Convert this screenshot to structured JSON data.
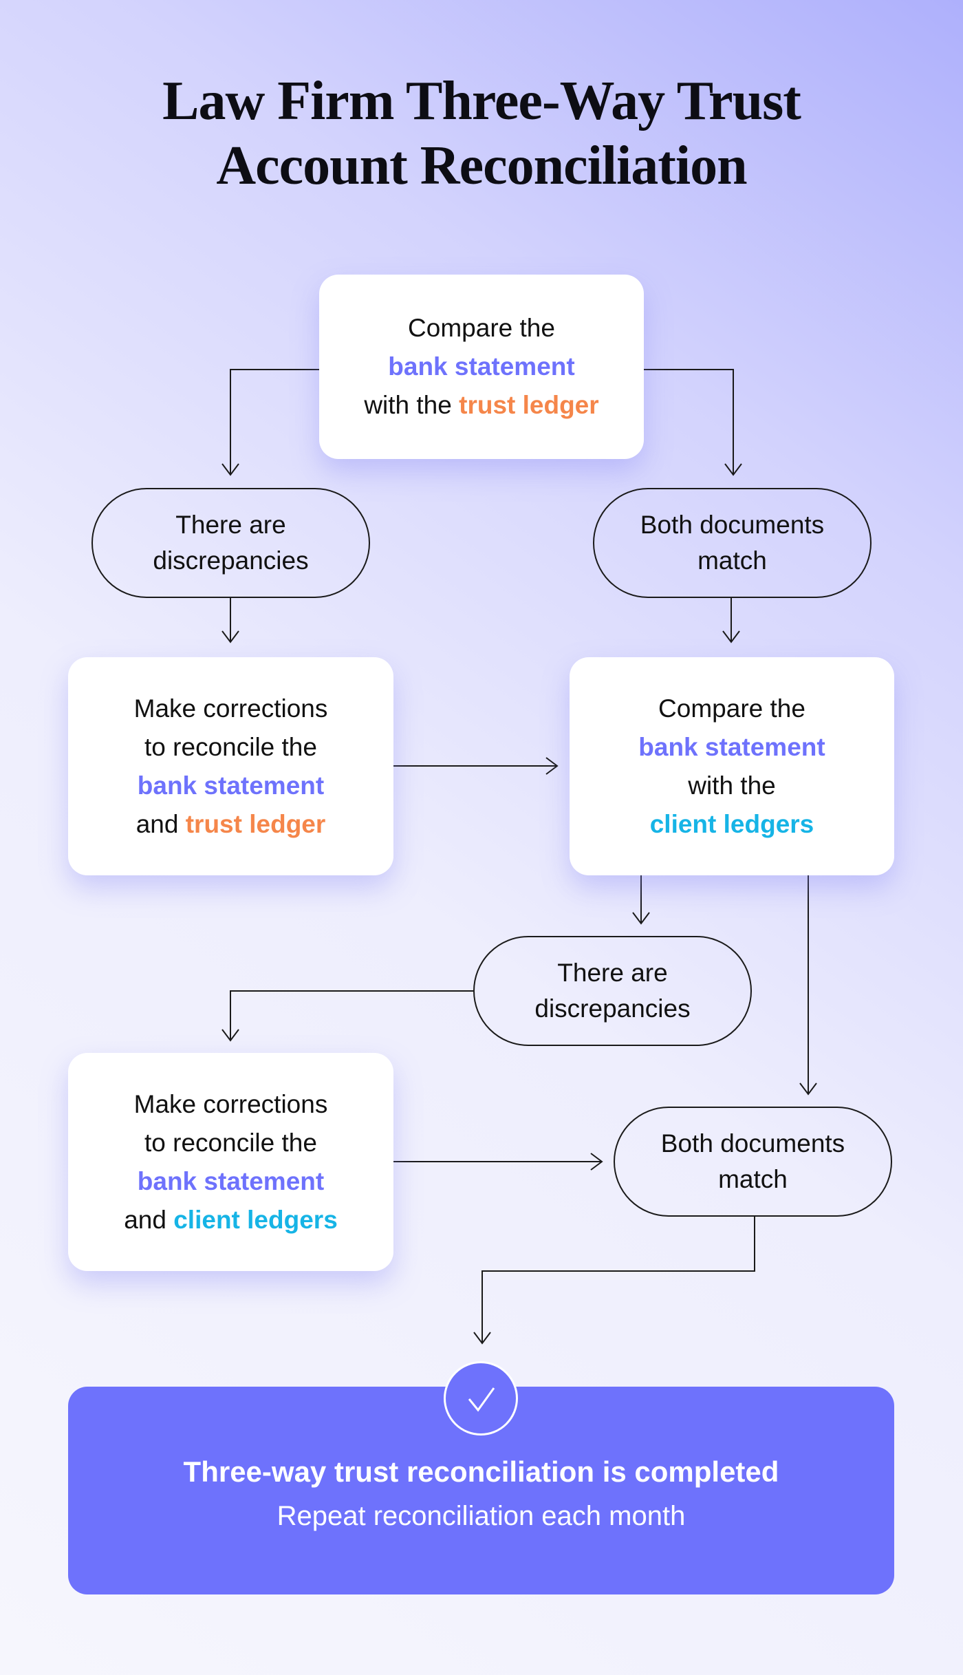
{
  "title_line1": "Law Firm Three-Way Trust",
  "title_line2": "Account Reconciliation",
  "colors": {
    "bank_statement": "#6e72fc",
    "trust_ledger": "#f5864a",
    "client_ledgers": "#16b4e6",
    "final_bg": "#6e72fc"
  },
  "step1": {
    "l1": "Compare the",
    "l2_hl": "bank statement",
    "l3": "with the ",
    "l3_hl": "trust ledger"
  },
  "branch1_left": {
    "l1": "There are",
    "l2": "discrepancies"
  },
  "branch1_right": {
    "l1": "Both documents",
    "l2": "match"
  },
  "fix1": {
    "l1": "Make corrections",
    "l2": "to reconcile the",
    "l3_hl": "bank statement",
    "l4": "and ",
    "l4_hl": "trust ledger"
  },
  "step2": {
    "l1": "Compare the",
    "l2_hl": "bank statement",
    "l3": "with the",
    "l4_hl": "client ledgers"
  },
  "branch2_disc": {
    "l1": "There are",
    "l2": "discrepancies"
  },
  "fix2": {
    "l1": "Make corrections",
    "l2": "to reconcile the",
    "l3_hl": "bank statement",
    "l4": "and ",
    "l4_hl": "client ledgers"
  },
  "branch2_match": {
    "l1": "Both documents",
    "l2": "match"
  },
  "final": {
    "icon": "check-icon",
    "title": "Three-way trust reconciliation is completed",
    "subtitle": "Repeat reconciliation each month"
  }
}
